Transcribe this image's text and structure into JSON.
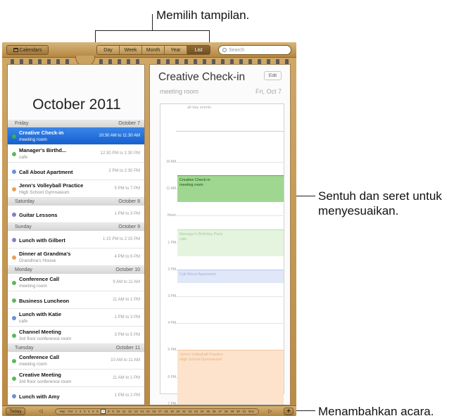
{
  "callouts": {
    "views": "Memilih tampilan.",
    "drag": "Sentuh dan seret untuk menyesuaikan.",
    "add": "Menambahkan acara."
  },
  "topbar": {
    "calendars_label": "Calendars",
    "calendars_icon": "calendar-icon",
    "views": [
      "Day",
      "Week",
      "Month",
      "Year",
      "List"
    ],
    "active_view": "List",
    "search_placeholder": "Search"
  },
  "list": {
    "month_title": "October 2011",
    "groups": [
      {
        "day": "Friday",
        "date": "October 7",
        "events": [
          {
            "title": "Creative Check-in",
            "sub": "meeting room",
            "time": "10:30 AM to 11:30 AM",
            "color": "#36b24a",
            "selected": true
          },
          {
            "title": "Manager's Birthd...",
            "sub": "cafe",
            "time": "12:30 PM to 1:30 PM",
            "color": "#5cb85c"
          },
          {
            "title": "Call About Apartment",
            "sub": "",
            "time": "2 PM to 2:30 PM",
            "color": "#6d8fd6"
          },
          {
            "title": "Jenn's Volleyball Practice",
            "sub": "High School Gymnasium",
            "time": "5 PM to 7 PM",
            "color": "#e8a05a"
          }
        ]
      },
      {
        "day": "Saturday",
        "date": "October 8",
        "events": [
          {
            "title": "Guitar Lessons",
            "sub": "",
            "time": "1 PM to 3 PM",
            "color": "#8a7bc9"
          }
        ]
      },
      {
        "day": "Sunday",
        "date": "October 9",
        "events": [
          {
            "title": "Lunch with Gilbert",
            "sub": "",
            "time": "1:15 PM to 2:15 PM",
            "color": "#8a7bc9"
          },
          {
            "title": "Dinner at Grandma's",
            "sub": "Grandma's House",
            "time": "4 PM to 6 PM",
            "color": "#e8a05a"
          }
        ]
      },
      {
        "day": "Monday",
        "date": "October 10",
        "events": [
          {
            "title": "Conference Call",
            "sub": "meeting room",
            "time": "9 AM to 11 AM",
            "color": "#5cb85c"
          },
          {
            "title": "Business Luncheon",
            "sub": "",
            "time": "11 AM to 1 PM",
            "color": "#5cb85c"
          },
          {
            "title": "Lunch with Katie",
            "sub": "cafe",
            "time": "1 PM to 3 PM",
            "color": "#6d8fd6"
          },
          {
            "title": "Channel Meeting",
            "sub": "3rd floor conference room",
            "time": "3 PM to 5 PM",
            "color": "#5cb85c"
          }
        ]
      },
      {
        "day": "Tuesday",
        "date": "October 11",
        "events": [
          {
            "title": "Conference Call",
            "sub": "meeting room",
            "time": "10 AM to 11 AM",
            "color": "#5cb85c"
          },
          {
            "title": "Creative Meeting",
            "sub": "3rd floor conference room",
            "time": "11 AM to 1 PM",
            "color": "#5cb85c"
          },
          {
            "title": "Lunch with Amy",
            "sub": "",
            "time": "1 PM to 2 PM",
            "color": "#6d8fd6"
          }
        ]
      }
    ]
  },
  "detail": {
    "title": "Creative Check-in",
    "edit_label": "Edit",
    "location": "meeting room",
    "date": "Fri, Oct 7",
    "allday_label": "all-day events",
    "hours": [
      "10 AM",
      "11 AM",
      "Noon",
      "1 PM",
      "2 PM",
      "3 PM",
      "4 PM",
      "5 PM",
      "6 PM",
      "7 PM"
    ],
    "blocks": [
      {
        "title": "Creative Check-in",
        "sub": "meeting room",
        "start": 10.5,
        "end": 11.5,
        "bg": "#9fd790",
        "border": "#4caf50",
        "text": "#234d1c"
      },
      {
        "title": "Manager's Birthday Party",
        "sub": "cafe",
        "start": 12.5,
        "end": 13.5,
        "bg": "#e4f4df",
        "border": "#b7dfae",
        "text": "#a9c9a2"
      },
      {
        "title": "Call About Apartment",
        "sub": "",
        "start": 14.0,
        "end": 14.5,
        "bg": "#dfe7f8",
        "border": "#b6c8ee",
        "text": "#a3b4d8"
      },
      {
        "title": "Jenn's Volleyball Practice",
        "sub": "High School Gymnasium",
        "start": 17.0,
        "end": 19.0,
        "bg": "#fde3cc",
        "border": "#f2c49b",
        "text": "#e3b07e"
      }
    ]
  },
  "bottom": {
    "today_label": "Today",
    "plus_label": "+",
    "prev_month": "Sep",
    "month": "Oct",
    "next_month": "Nov",
    "days": [
      "1",
      "2",
      "3",
      "4",
      "5",
      "6",
      "7",
      "8",
      "9",
      "10",
      "11",
      "12",
      "13",
      "14",
      "15",
      "16",
      "17",
      "18",
      "19",
      "20",
      "21",
      "22",
      "23",
      "24",
      "25",
      "26",
      "27",
      "28",
      "29",
      "30",
      "31"
    ],
    "selected_day": "7",
    "prev_icon": "back-arrow-icon",
    "next_icon": "forward-arrow-icon"
  }
}
